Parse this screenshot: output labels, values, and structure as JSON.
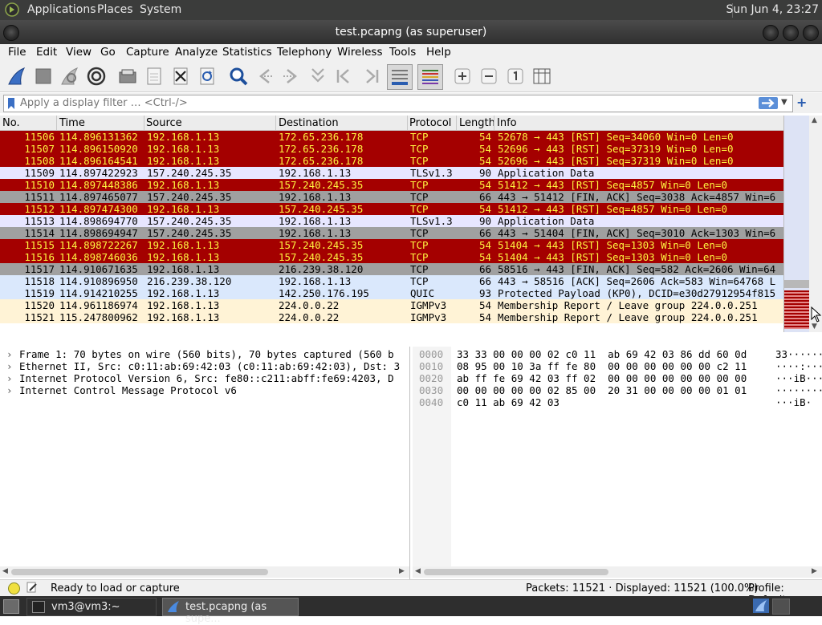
{
  "top_panel": {
    "menus": [
      "Applications",
      "Places",
      "System"
    ],
    "clock": "Sun Jun  4, 23:27"
  },
  "window": {
    "title": "test.pcapng (as superuser)"
  },
  "menu_bar": [
    "File",
    "Edit",
    "View",
    "Go",
    "Capture",
    "Analyze",
    "Statistics",
    "Telephony",
    "Wireless",
    "Tools",
    "Help"
  ],
  "filter": {
    "placeholder": "Apply a display filter … <Ctrl-/>"
  },
  "columns": [
    "No.",
    "Time",
    "Source",
    "Destination",
    "Protocol",
    "Length",
    "Info"
  ],
  "colors": {
    "rst": "#a40000",
    "rst_text": "#fff440",
    "gray": "#a0a0a0",
    "tls": "#e7e6ff",
    "tcp_light": "#dae8fc",
    "igmp": "#fff3d6"
  },
  "packets": [
    {
      "no": "11506",
      "time": "114.896131362",
      "src": "192.168.1.13",
      "dst": "172.65.236.178",
      "proto": "TCP",
      "len": "54",
      "info": "52678 → 443 [RST] Seq=34060 Win=0 Len=0",
      "style": "rst"
    },
    {
      "no": "11507",
      "time": "114.896150920",
      "src": "192.168.1.13",
      "dst": "172.65.236.178",
      "proto": "TCP",
      "len": "54",
      "info": "52696 → 443 [RST] Seq=37319 Win=0 Len=0",
      "style": "rst"
    },
    {
      "no": "11508",
      "time": "114.896164541",
      "src": "192.168.1.13",
      "dst": "172.65.236.178",
      "proto": "TCP",
      "len": "54",
      "info": "52696 → 443 [RST] Seq=37319 Win=0 Len=0",
      "style": "rst"
    },
    {
      "no": "11509",
      "time": "114.897422923",
      "src": "157.240.245.35",
      "dst": "192.168.1.13",
      "proto": "TLSv1.3",
      "len": "90",
      "info": "Application Data",
      "style": "tls"
    },
    {
      "no": "11510",
      "time": "114.897448386",
      "src": "192.168.1.13",
      "dst": "157.240.245.35",
      "proto": "TCP",
      "len": "54",
      "info": "51412 → 443 [RST] Seq=4857 Win=0 Len=0",
      "style": "rst"
    },
    {
      "no": "11511",
      "time": "114.897465077",
      "src": "157.240.245.35",
      "dst": "192.168.1.13",
      "proto": "TCP",
      "len": "66",
      "info": "443 → 51412 [FIN, ACK] Seq=3038 Ack=4857 Win=6",
      "style": "gray"
    },
    {
      "no": "11512",
      "time": "114.897474300",
      "src": "192.168.1.13",
      "dst": "157.240.245.35",
      "proto": "TCP",
      "len": "54",
      "info": "51412 → 443 [RST] Seq=4857 Win=0 Len=0",
      "style": "rst"
    },
    {
      "no": "11513",
      "time": "114.898694770",
      "src": "157.240.245.35",
      "dst": "192.168.1.13",
      "proto": "TLSv1.3",
      "len": "90",
      "info": "Application Data",
      "style": "tls"
    },
    {
      "no": "11514",
      "time": "114.898694947",
      "src": "157.240.245.35",
      "dst": "192.168.1.13",
      "proto": "TCP",
      "len": "66",
      "info": "443 → 51404 [FIN, ACK] Seq=3010 Ack=1303 Win=6",
      "style": "gray"
    },
    {
      "no": "11515",
      "time": "114.898722267",
      "src": "192.168.1.13",
      "dst": "157.240.245.35",
      "proto": "TCP",
      "len": "54",
      "info": "51404 → 443 [RST] Seq=1303 Win=0 Len=0",
      "style": "rst"
    },
    {
      "no": "11516",
      "time": "114.898746036",
      "src": "192.168.1.13",
      "dst": "157.240.245.35",
      "proto": "TCP",
      "len": "54",
      "info": "51404 → 443 [RST] Seq=1303 Win=0 Len=0",
      "style": "rst"
    },
    {
      "no": "11517",
      "time": "114.910671635",
      "src": "192.168.1.13",
      "dst": "216.239.38.120",
      "proto": "TCP",
      "len": "66",
      "info": "58516 → 443 [FIN, ACK] Seq=582 Ack=2606 Win=64",
      "style": "gray"
    },
    {
      "no": "11518",
      "time": "114.910896950",
      "src": "216.239.38.120",
      "dst": "192.168.1.13",
      "proto": "TCP",
      "len": "66",
      "info": "443 → 58516 [ACK] Seq=2606 Ack=583 Win=64768 L",
      "style": "tcp_light"
    },
    {
      "no": "11519",
      "time": "114.914210255",
      "src": "192.168.1.13",
      "dst": "142.250.176.195",
      "proto": "QUIC",
      "len": "93",
      "info": "Protected Payload (KP0), DCID=e30d27912954f815",
      "style": "tcp_light"
    },
    {
      "no": "11520",
      "time": "114.961186974",
      "src": "192.168.1.13",
      "dst": "224.0.0.22",
      "proto": "IGMPv3",
      "len": "54",
      "info": "Membership Report / Leave group 224.0.0.251",
      "style": "igmp"
    },
    {
      "no": "11521",
      "time": "115.247800962",
      "src": "192.168.1.13",
      "dst": "224.0.0.22",
      "proto": "IGMPv3",
      "len": "54",
      "info": "Membership Report / Leave group 224.0.0.251",
      "style": "igmp"
    }
  ],
  "details": [
    "Frame 1: 70 bytes on wire (560 bits), 70 bytes captured (560 b",
    "Ethernet II, Src: c0:11:ab:69:42:03 (c0:11:ab:69:42:03), Dst: 3",
    "Internet Protocol Version 6, Src: fe80::c211:abff:fe69:4203, D",
    "Internet Control Message Protocol v6"
  ],
  "bytes": [
    {
      "off": "0000",
      "hex": "33 33 00 00 00 02 c0 11  ab 69 42 03 86 dd 60 0d",
      "ascii": "33······"
    },
    {
      "off": "0010",
      "hex": "08 95 00 10 3a ff fe 80  00 00 00 00 00 00 c2 11",
      "ascii": "····:···"
    },
    {
      "off": "0020",
      "hex": "ab ff fe 69 42 03 ff 02  00 00 00 00 00 00 00 00",
      "ascii": "···iB···"
    },
    {
      "off": "0030",
      "hex": "00 00 00 00 00 02 85 00  20 31 00 00 00 00 01 01",
      "ascii": "········"
    },
    {
      "off": "0040",
      "hex": "c0 11 ab 69 42 03",
      "ascii": "···iB·"
    }
  ],
  "status": {
    "ready": "Ready to load or capture",
    "packets": "Packets: 11521 · Displayed: 11521 (100.0%)",
    "profile": "Profile: Default"
  },
  "taskbar": {
    "terminal": "vm3@vm3:~",
    "wireshark": "test.pcapng (as supe..."
  }
}
